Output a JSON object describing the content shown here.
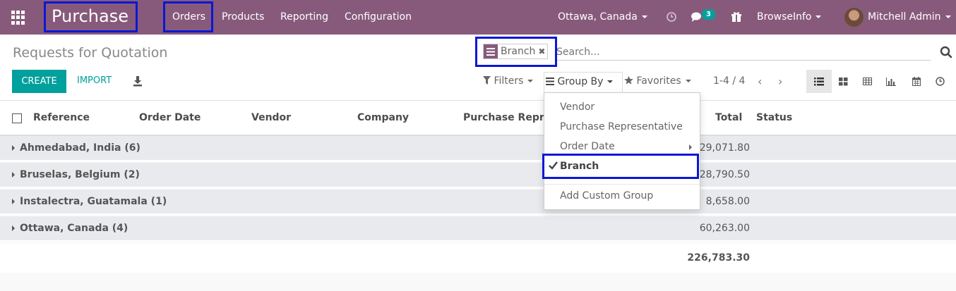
{
  "navbar": {
    "app_title": "Purchase",
    "menu": [
      "Orders",
      "Products",
      "Reporting",
      "Configuration"
    ],
    "branch": "Ottawa, Canada",
    "messages_count": "3",
    "company": "BrowseInfo",
    "user": "Mitchell Admin"
  },
  "control": {
    "breadcrumb": "Requests for Quotation",
    "facet_label": "Branch",
    "search_placeholder": "Search...",
    "create_label": "CREATE",
    "import_label": "IMPORT",
    "filters_label": "Filters",
    "groupby_label": "Group By",
    "favorites_label": "Favorites",
    "pager": "1-4 / 4"
  },
  "table": {
    "columns": [
      "Reference",
      "Order Date",
      "Vendor",
      "Company",
      "Purchase Repr",
      "Total",
      "Status"
    ],
    "groups": [
      {
        "name": "Ahmedabad, India (6)",
        "total": "29,071.80"
      },
      {
        "name": "Bruselas, Belgium (2)",
        "total": "28,790.50"
      },
      {
        "name": "Instalectra, Guatamala (1)",
        "total": "8,658.00"
      },
      {
        "name": "Ottawa, Canada (4)",
        "total": "60,263.00"
      }
    ],
    "grand_total": "226,783.30"
  },
  "groupby_menu": {
    "items": [
      "Vendor",
      "Purchase Representative",
      "Order Date",
      "Branch"
    ],
    "selected": "Branch",
    "custom": "Add Custom Group"
  },
  "colors": {
    "brand": "#875a7b",
    "accent": "#00a09d",
    "highlight_box": "#0a17d6"
  }
}
